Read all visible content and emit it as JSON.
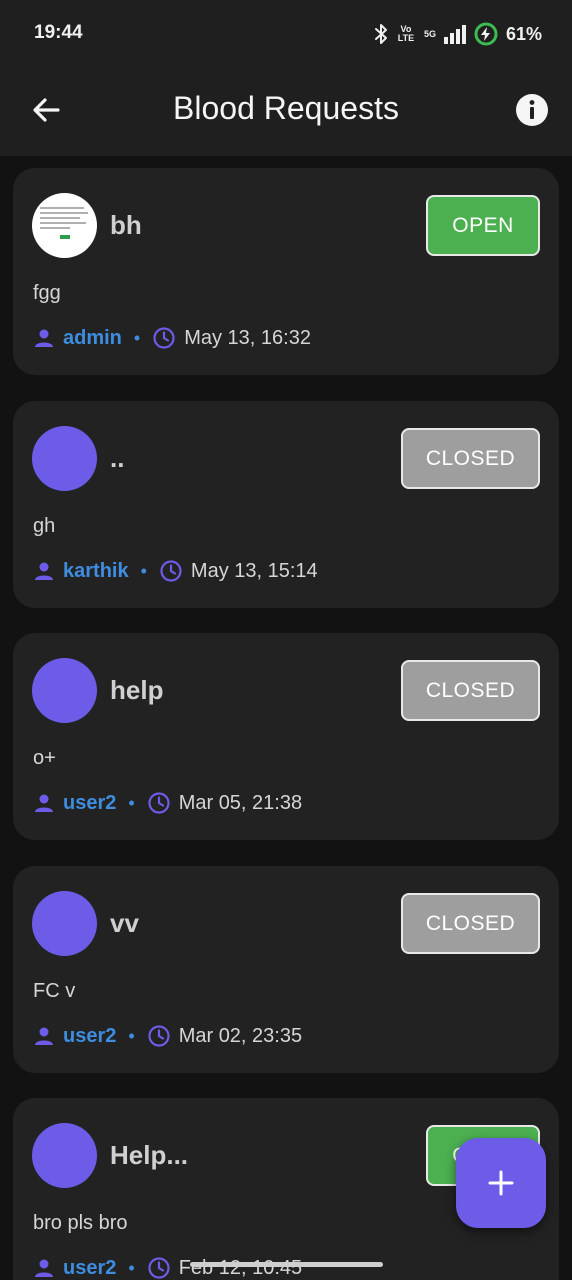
{
  "status_bar": {
    "time": "19:44",
    "volte": "Vo LTE",
    "network": "5G",
    "battery": "61%",
    "icons": [
      "bluetooth-icon",
      "volte-icon",
      "signal-icon",
      "battery-charging-icon"
    ]
  },
  "app_bar": {
    "title": "Blood Requests",
    "back_icon": "arrow-left-icon",
    "info_icon": "info-icon"
  },
  "requests": [
    {
      "title": "bh",
      "description": "fgg",
      "user": "admin",
      "time": "May 13, 16:32",
      "status": "OPEN",
      "avatar": "image-thumbnail"
    },
    {
      "title": "..",
      "description": "gh",
      "user": "karthik",
      "time": "May 13, 15:14",
      "status": "CLOSED",
      "avatar": "placeholder"
    },
    {
      "title": "help",
      "description": "o+",
      "user": "user2",
      "time": "Mar 05, 21:38",
      "status": "CLOSED",
      "avatar": "placeholder"
    },
    {
      "title": "vv",
      "description": "FC v",
      "user": "user2",
      "time": "Mar 02, 23:35",
      "status": "CLOSED",
      "avatar": "placeholder"
    },
    {
      "title": "Help...",
      "description": "bro pls bro",
      "user": "user2",
      "time": "Feb 12, 10:45",
      "status": "OPEN",
      "avatar": "placeholder"
    }
  ],
  "fab": {
    "icon": "plus-icon"
  },
  "colors": {
    "accent": "#6c5ce7",
    "open": "#4caf50",
    "closed": "#9e9e9e",
    "link": "#3d8de0",
    "card": "#222222",
    "background": "#121212"
  }
}
